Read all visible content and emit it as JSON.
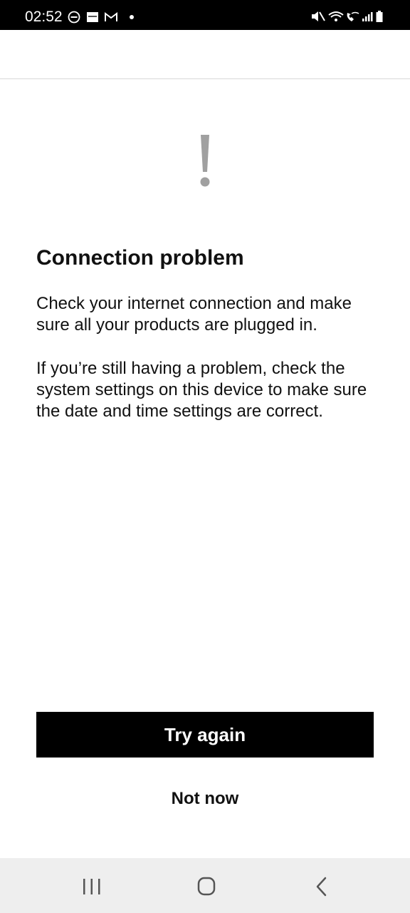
{
  "status_bar": {
    "time": "02:52",
    "left_icons": [
      "do-not-disturb-icon",
      "image-notification-icon",
      "gmail-icon",
      "dot-icon"
    ],
    "right_icons": [
      "mute-icon",
      "wifi-icon",
      "wifi-calling-icon",
      "signal-icon",
      "battery-icon"
    ]
  },
  "content": {
    "icon": "exclamation-icon",
    "title": "Connection problem",
    "paragraph_1": "Check your internet connection and make sure all your products are plugged in.",
    "paragraph_2": "If you’re still having a problem, check the system settings on this device to make sure the date and time settings are correct."
  },
  "actions": {
    "primary_label": "Try again",
    "secondary_label": "Not now"
  },
  "nav_bar": {
    "icons": [
      "recents-icon",
      "home-icon",
      "back-icon"
    ]
  },
  "colors": {
    "primary_button": "#000000",
    "primary_button_text": "#ffffff",
    "alert_icon": "#a0a0a0",
    "nav_bar_bg": "#eeeeee"
  }
}
